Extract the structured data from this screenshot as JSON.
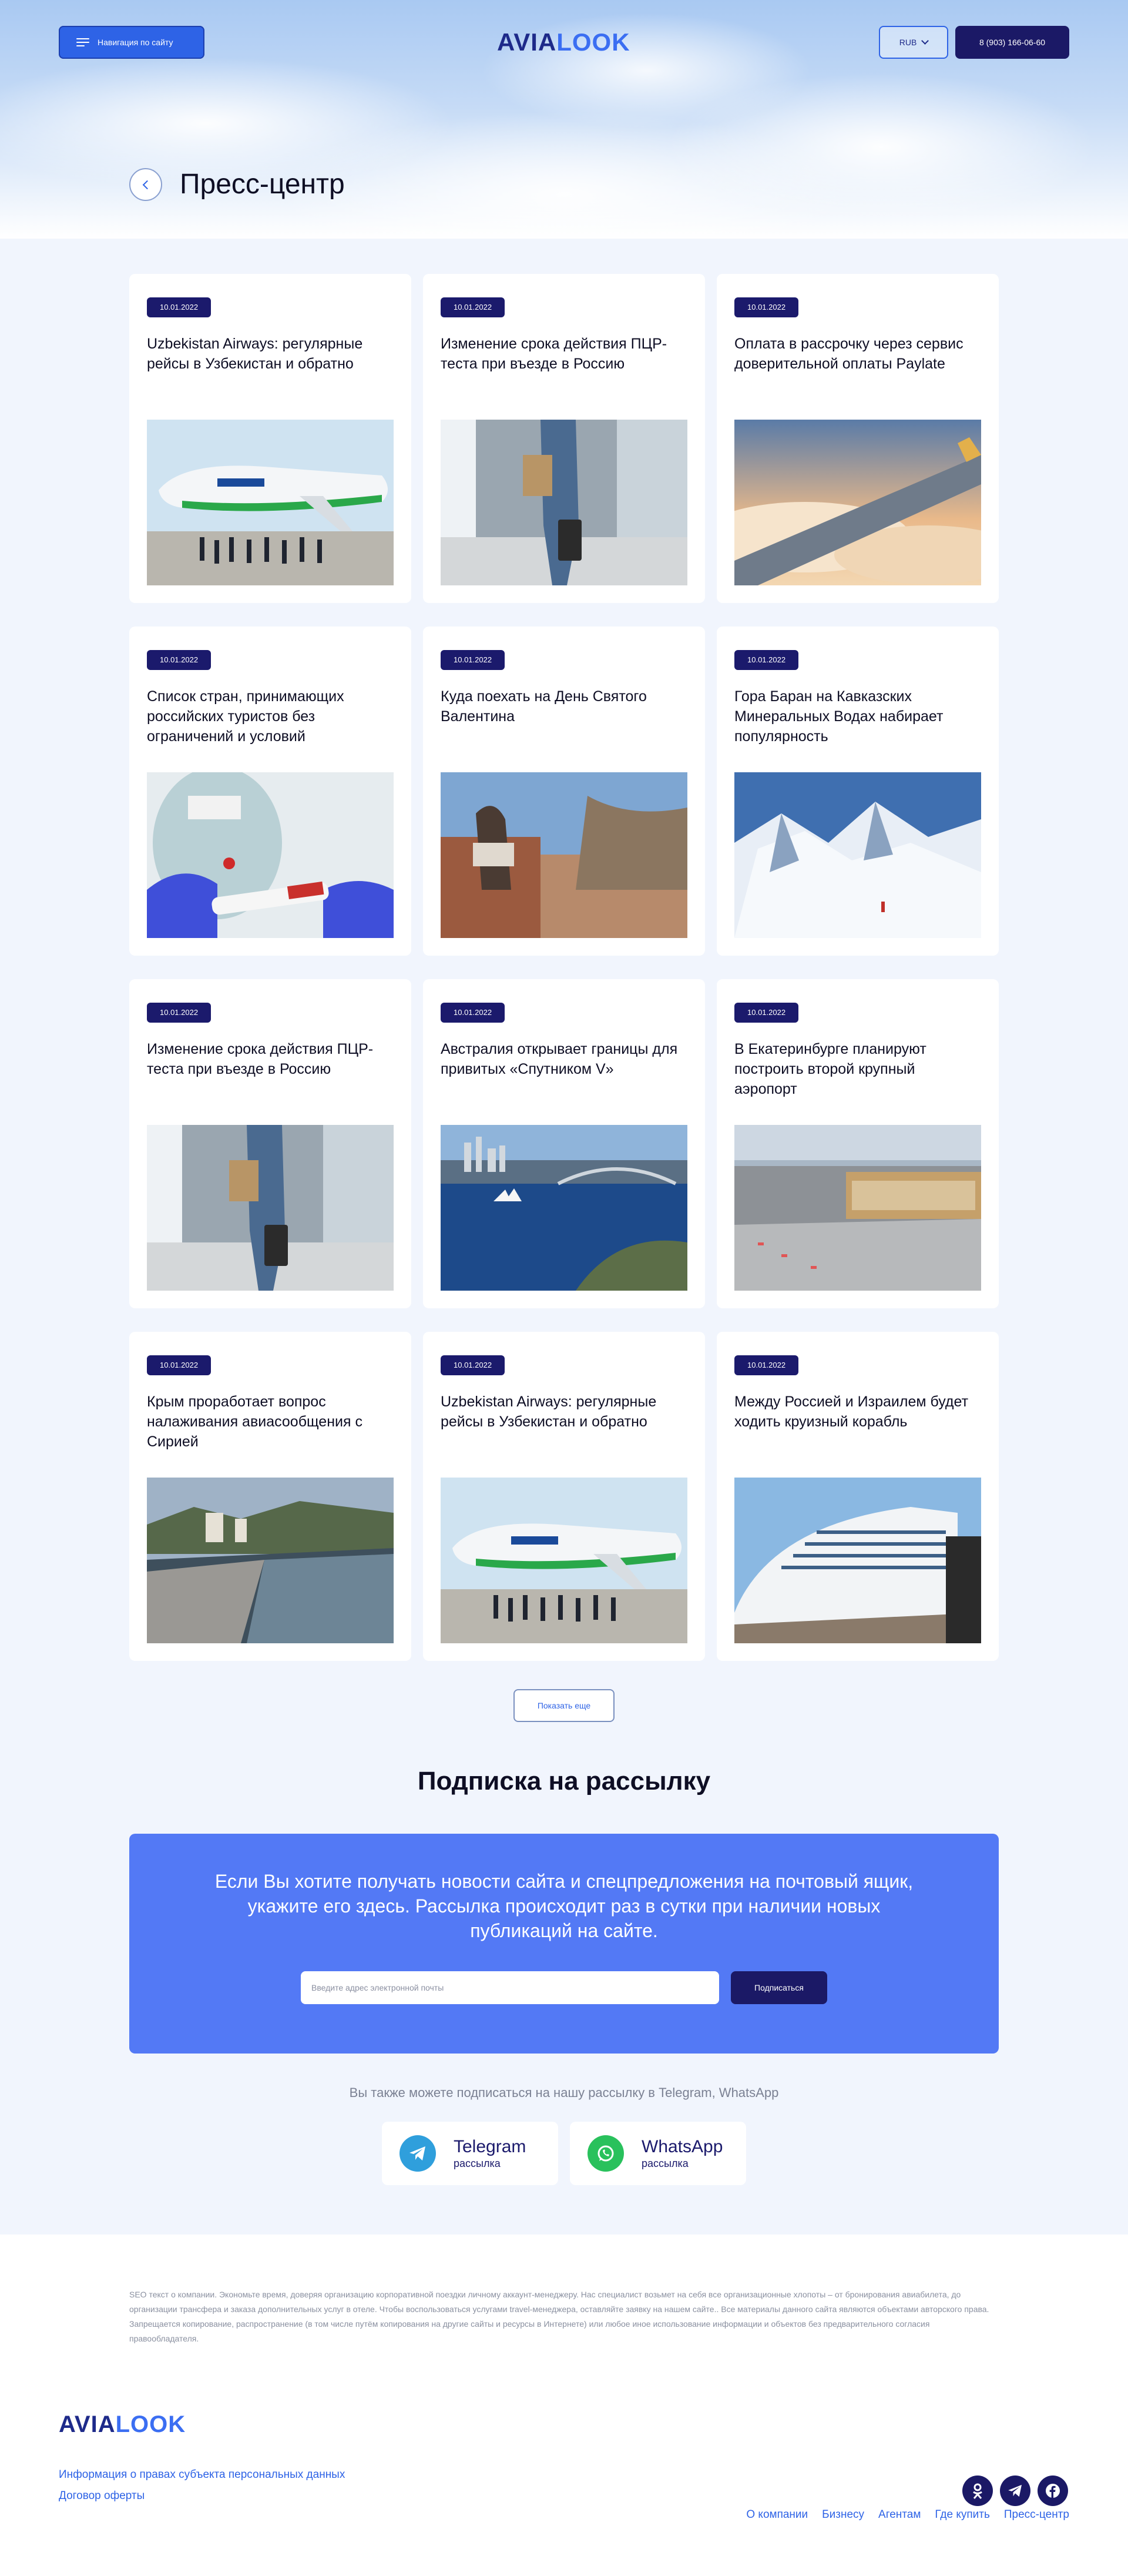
{
  "header": {
    "nav_button": "Навигация по сайту",
    "logo_part1": "AVIA",
    "logo_part2": "LOOK",
    "currency": "RUB",
    "phone": "8 (903) 166-06-60"
  },
  "page": {
    "title": "Пресс-центр"
  },
  "news": [
    {
      "date": "10.01.2022",
      "title": "Uzbekistan Airways: регулярные рейсы в Узбекистан и обратно",
      "image": "airplane-crew-photo"
    },
    {
      "date": "10.01.2022",
      "title": "Изменение срока действия ПЦР-теста при въезде в Россию",
      "image": "airport-walking-photo"
    },
    {
      "date": "10.01.2022",
      "title": "Оплата в рассрочку через сервис доверительной оплаты Paylate",
      "image": "wing-clouds-photo"
    },
    {
      "date": "10.01.2022",
      "title": "Список стран, принимающих российских туристов без ограничений и условий",
      "image": "covid-test-photo"
    },
    {
      "date": "10.01.2022",
      "title": "Куда поехать на День Святого Валентина",
      "image": "couple-city-photo"
    },
    {
      "date": "10.01.2022",
      "title": "Гора Баран на Кавказских Минеральных Водах набирает популярность",
      "image": "snow-mountains-photo"
    },
    {
      "date": "10.01.2022",
      "title": "Изменение срока действия ПЦР-теста при въезде в Россию",
      "image": "airport-walking-photo"
    },
    {
      "date": "10.01.2022",
      "title": "Австралия открывает границы для привитых «Спутником V»",
      "image": "sydney-harbour-photo"
    },
    {
      "date": "10.01.2022",
      "title": "В Екатеринбурге планируют построить второй крупный аэропорт",
      "image": "airport-aerial-photo"
    },
    {
      "date": "10.01.2022",
      "title": "Крым проработает вопрос налаживания авиасообщения с Сирией",
      "image": "yalta-embankment-photo"
    },
    {
      "date": "10.01.2022",
      "title": "Uzbekistan Airways: регулярные рейсы в Узбекистан и обратно",
      "image": "airplane-crew-photo"
    },
    {
      "date": "10.01.2022",
      "title": "Между Россией и Израилем будет ходить круизный корабль",
      "image": "cruise-ship-photo"
    }
  ],
  "show_more": "Показать еще",
  "subscription": {
    "heading": "Подписка на рассылку",
    "text": "Если Вы хотите получать новости сайта и спецпредложения на почтовый ящик, укажите его здесь. Рассылка происходит раз в сутки при наличии новых публикаций на сайте.",
    "email_placeholder": "Введите адрес электронной почты",
    "button": "Подписаться",
    "also": "Вы также можете подписаться на нашу рассылку в Telegram, WhatsApp",
    "telegram_name": "Telegram",
    "telegram_sub": "рассылка",
    "whatsapp_name": "WhatsApp",
    "whatsapp_sub": "рассылка"
  },
  "footer": {
    "seo": "SEO текст о компании. Экономьте время, доверяя организацию корпоративной поездки личному аккаунт-менеджеру. Нас специалист возьмет на себя все организационные хлопоты – от бронирования авиабилета, до организации трансфера и заказа дополнительных услуг в отеле. Чтобы воспользоваться услугами travel-менеджера, оставляйте заявку на нашем сайте.. Все материалы данного сайта являются объектами авторского права. Запрещается копирование, распространение (в том числе путём копирования на другие сайты и ресурсы в Интернете) или любое иное использование информации и объектов без предварительного согласия правообладателя.",
    "link_privacy": "Информация о правах субъекта персональных данных",
    "link_offer": "Договор оферты",
    "nav": [
      "О компании",
      "Бизнесу",
      "Агентам",
      "Где купить",
      "Пресс-центр"
    ],
    "social": [
      "odnoklassniki-icon",
      "telegram-icon",
      "facebook-icon"
    ]
  },
  "colors": {
    "primary": "#2e63e6",
    "dark": "#1b1966",
    "subscribe_bg": "#5379f5",
    "page_bg": "#f1f5fd"
  }
}
